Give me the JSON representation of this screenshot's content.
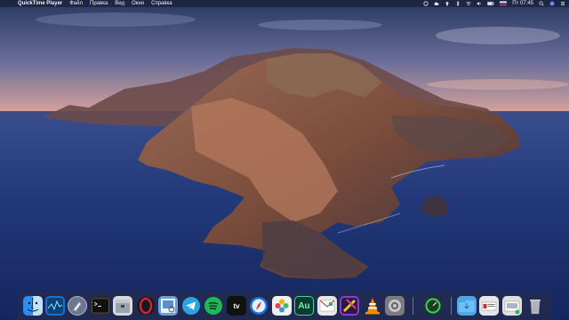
{
  "menubar": {
    "apple_glyph": "",
    "app_name": "QuickTime Player",
    "menus": [
      "Файл",
      "Правка",
      "Вид",
      "Окно",
      "Справка"
    ],
    "clock": "Пт 07:45"
  },
  "dock": {
    "items": [
      {
        "name": "finder",
        "color": "#2b8ef0"
      },
      {
        "name": "activity-monitor",
        "color": "#1a6fd0"
      },
      {
        "name": "launchpad",
        "color": "#b0b8c8"
      },
      {
        "name": "terminal",
        "color": "#2a2a2a"
      },
      {
        "name": "archive-utility",
        "color": "#d8d8d8"
      },
      {
        "name": "opera",
        "color": "#e2203b"
      },
      {
        "name": "preview",
        "color": "#6aa0d8"
      },
      {
        "name": "telegram",
        "color": "#2aa3e0"
      },
      {
        "name": "spotify",
        "color": "#1db954"
      },
      {
        "name": "apple-tv",
        "color": "#111111"
      },
      {
        "name": "safari-browser",
        "color": "#1b6fd8"
      },
      {
        "name": "photos",
        "color": "#f0f0f0"
      },
      {
        "name": "adobe-audition",
        "color": "#0b3b2c"
      },
      {
        "name": "mail",
        "color": "#e8e8e8"
      },
      {
        "name": "final-cut-pro",
        "color": "#8b3bd6"
      },
      {
        "name": "vlc",
        "color": "#f08a00"
      },
      {
        "name": "system-preferences",
        "color": "#7a7a80"
      },
      {
        "name": "istat-menus",
        "color": "#2f9a4a"
      },
      {
        "name": "downloads-folder",
        "color": "#4aa7e8"
      },
      {
        "name": "stack-documents",
        "color": "#e6e6e6"
      },
      {
        "name": "stack-screens",
        "color": "#e0e0e0"
      },
      {
        "name": "trash",
        "color": "#b8bcc4"
      }
    ],
    "au_label": "Au",
    "tv_label": "tv"
  }
}
